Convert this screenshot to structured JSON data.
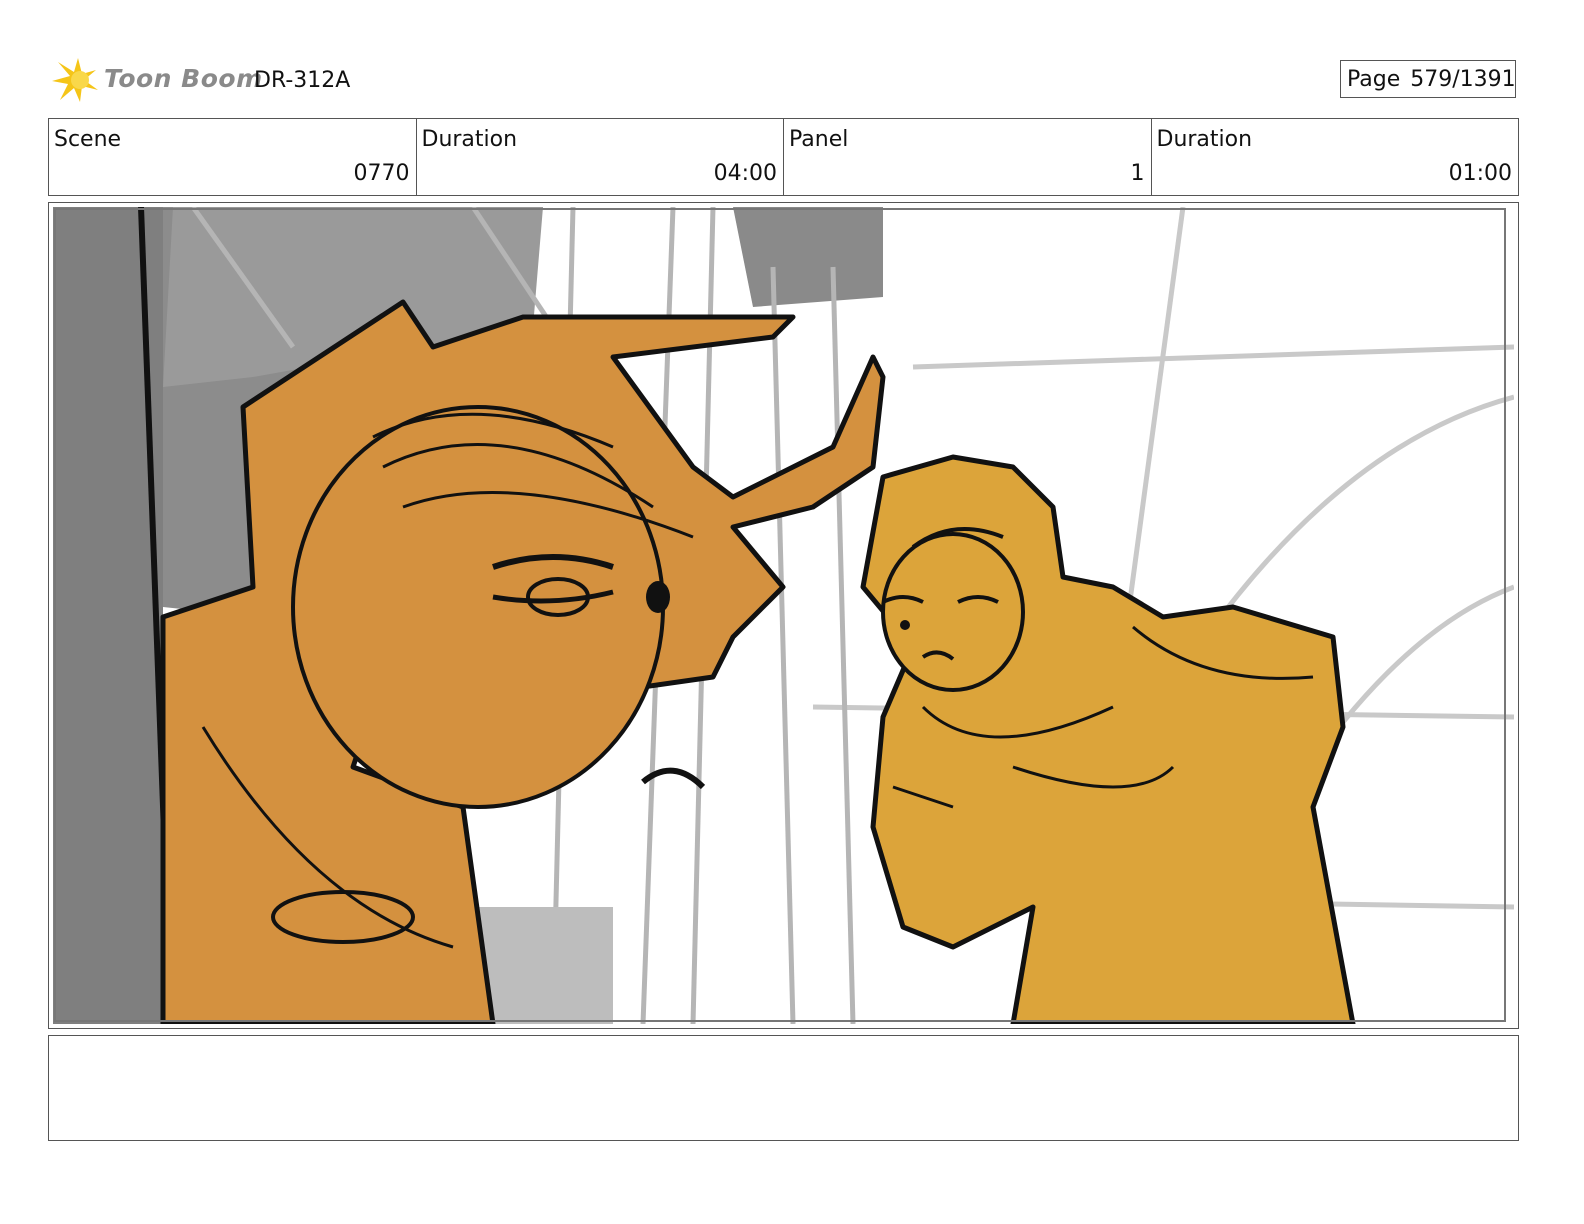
{
  "header": {
    "logo_text": "Toon Boom",
    "project_code": "DR-312A",
    "page_label": "Page",
    "page_value": "579/1391"
  },
  "info": {
    "scene_label": "Scene",
    "scene_value": "0770",
    "scene_duration_label": "Duration",
    "scene_duration_value": "04:00",
    "panel_label": "Panel",
    "panel_value": "1",
    "panel_duration_label": "Duration",
    "panel_duration_value": "01:00"
  },
  "colors": {
    "creature_orange": "#d4913f",
    "character_yellow": "#dca43a",
    "background_gray": "#8a8a8a",
    "logo_yellow": "#f5c518"
  }
}
